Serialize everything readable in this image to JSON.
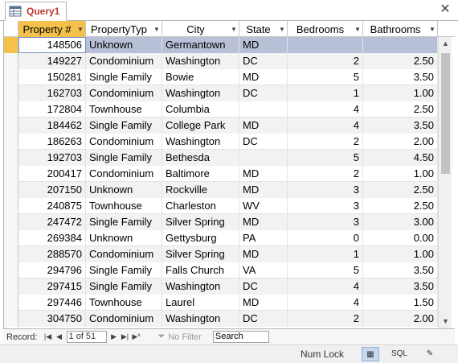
{
  "tab": {
    "label": "Query1"
  },
  "columns": [
    "Property #",
    "PropertyTyp",
    "City",
    "State",
    "Bedrooms",
    "Bathrooms"
  ],
  "rows": [
    [
      "148506",
      "Unknown",
      "Germantown",
      "MD",
      "",
      ""
    ],
    [
      "149227",
      "Condominium",
      "Washington",
      "DC",
      "2",
      "2.50"
    ],
    [
      "150281",
      "Single Family",
      "Bowie",
      "MD",
      "5",
      "3.50"
    ],
    [
      "162703",
      "Condominium",
      "Washington",
      "DC",
      "1",
      "1.00"
    ],
    [
      "172804",
      "Townhouse",
      "Columbia",
      "",
      "4",
      "2.50"
    ],
    [
      "184462",
      "Single Family",
      "College Park",
      "MD",
      "4",
      "3.50"
    ],
    [
      "186263",
      "Condominium",
      "Washington",
      "DC",
      "2",
      "2.00"
    ],
    [
      "192703",
      "Single Family",
      "Bethesda",
      "",
      "5",
      "4.50"
    ],
    [
      "200417",
      "Condominium",
      "Baltimore",
      "MD",
      "2",
      "1.00"
    ],
    [
      "207150",
      "Unknown",
      "Rockville",
      "MD",
      "3",
      "2.50"
    ],
    [
      "240875",
      "Townhouse",
      "Charleston",
      "WV",
      "3",
      "2.50"
    ],
    [
      "247472",
      "Single Family",
      "Silver Spring",
      "MD",
      "3",
      "3.00"
    ],
    [
      "269384",
      "Unknown",
      "Gettysburg",
      "PA",
      "0",
      "0.00"
    ],
    [
      "288570",
      "Condominium",
      "Silver Spring",
      "MD",
      "1",
      "1.00"
    ],
    [
      "294796",
      "Single Family",
      "Falls Church",
      "VA",
      "5",
      "3.50"
    ],
    [
      "297415",
      "Single Family",
      "Washington",
      "DC",
      "4",
      "3.50"
    ],
    [
      "297446",
      "Townhouse",
      "Laurel",
      "MD",
      "4",
      "1.50"
    ],
    [
      "304750",
      "Condominium",
      "Washington",
      "DC",
      "2",
      "2.00"
    ]
  ],
  "navigation": {
    "record_label": "Record:",
    "position": "1 of 51",
    "no_filter": "No Filter",
    "search": "Search"
  },
  "status": {
    "num_lock": "Num Lock",
    "sql_label": "SQL"
  },
  "colors": {
    "header_selected": "#f4c24b",
    "current_row": "#b8c0d8",
    "tab_label": "#c0392b"
  }
}
